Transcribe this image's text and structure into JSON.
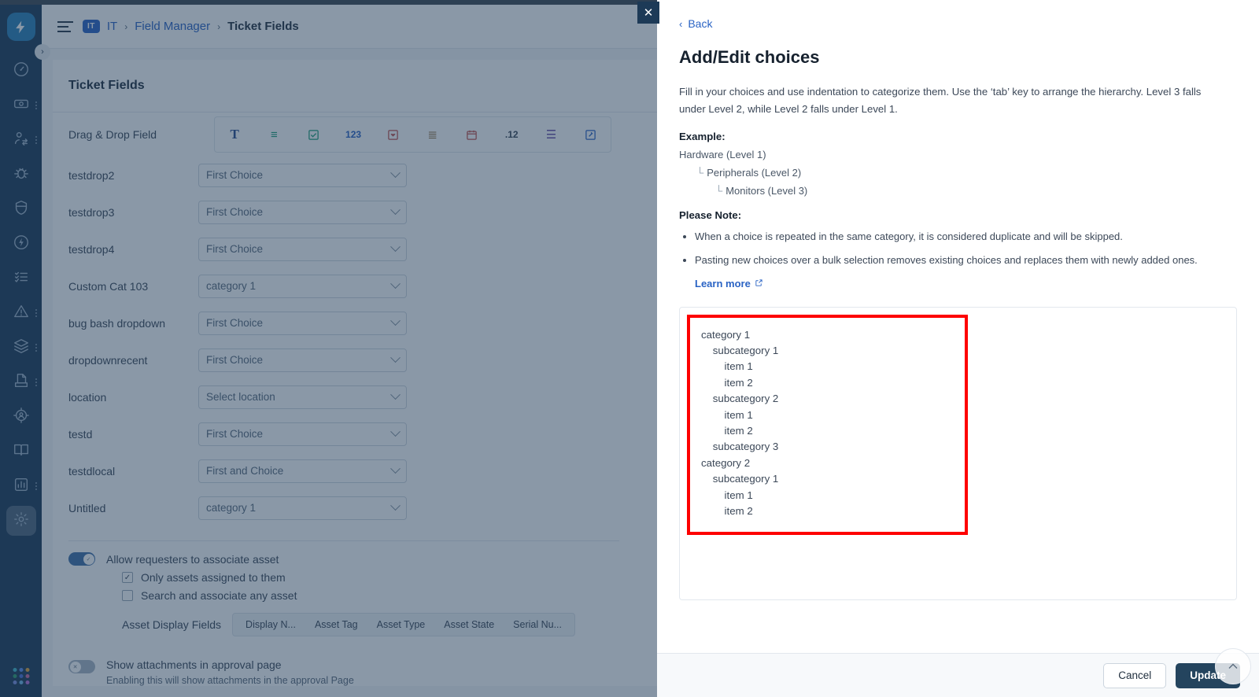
{
  "sidebar": {
    "logo_icon": "bolt-logo-icon",
    "expand_icon": "chevron-right-icon",
    "items": [
      {
        "icon": "gauge-icon",
        "name": "dashboard",
        "dots": false,
        "active": false
      },
      {
        "icon": "ticket-icon",
        "name": "tickets",
        "dots": true,
        "active": false
      },
      {
        "icon": "user-switch-icon",
        "name": "requesters",
        "dots": true,
        "active": false
      },
      {
        "icon": "bug-icon",
        "name": "problems",
        "dots": false,
        "active": false
      },
      {
        "icon": "shield-icon",
        "name": "changes",
        "dots": false,
        "active": false
      },
      {
        "icon": "bolt-circle-icon",
        "name": "releases",
        "dots": false,
        "active": false
      },
      {
        "icon": "checklist-icon",
        "name": "tasks",
        "dots": false,
        "active": false
      },
      {
        "icon": "warning-triangle-icon",
        "name": "alerts",
        "dots": true,
        "active": false
      },
      {
        "icon": "layers-icon",
        "name": "assets",
        "dots": true,
        "active": false
      },
      {
        "icon": "contract-icon",
        "name": "contracts",
        "dots": true,
        "active": false
      },
      {
        "icon": "target-user-icon",
        "name": "projects",
        "dots": false,
        "active": false
      },
      {
        "icon": "book-icon",
        "name": "knowledge-base",
        "dots": false,
        "active": false
      },
      {
        "icon": "chart-icon",
        "name": "analytics",
        "dots": true,
        "active": false
      },
      {
        "icon": "gear-icon",
        "name": "admin-settings",
        "dots": false,
        "active": true
      }
    ],
    "apps_grid_icon": "apps-grid-icon",
    "grid_colors": [
      "#3fb6c8",
      "#5b8def",
      "#e0a43a",
      "#2f9e6f",
      "#4a6fd8",
      "#c86a9e",
      "#7a8fe0",
      "#6fb7e8",
      "#b46fd8"
    ]
  },
  "app": {
    "menu_icon": "hamburger-icon",
    "breadcrumb": {
      "badge": "IT",
      "root": "IT",
      "sep": "›",
      "middle": "Field Manager",
      "current": "Ticket Fields"
    },
    "page_title": "Ticket Fields",
    "drag_drop_label": "Drag & Drop Field",
    "field_types": [
      {
        "name": "text-field-type",
        "glyph": "T",
        "color": "#2a4d8f"
      },
      {
        "name": "paragraph-field-type",
        "glyph": "≡",
        "color": "#1d9e78"
      },
      {
        "name": "checkbox-field-type",
        "glyph": "☑",
        "color": "#1d9e78"
      },
      {
        "name": "number-field-type",
        "glyph": "123",
        "color": "#2a63c4"
      },
      {
        "name": "dropdown-field-type",
        "glyph": "▼",
        "color": "#c0504d"
      },
      {
        "name": "multiselect-field-type",
        "glyph": "≣",
        "color": "#8a6a3a"
      },
      {
        "name": "date-field-type",
        "glyph": "Ὄ5",
        "color": "#c0504d"
      },
      {
        "name": "decimal-field-type",
        "glyph": ".12",
        "color": "#3c4858"
      },
      {
        "name": "list-field-type",
        "glyph": "☰",
        "color": "#6a4fa8"
      },
      {
        "name": "custom-field-type",
        "glyph": "✎",
        "color": "#2a63c4"
      }
    ],
    "rows": [
      {
        "label": "testdrop2",
        "value": "First Choice"
      },
      {
        "label": "testdrop3",
        "value": "First Choice"
      },
      {
        "label": "testdrop4",
        "value": "First Choice"
      },
      {
        "label": "Custom Cat 103",
        "value": "category 1"
      },
      {
        "label": "bug bash dropdown",
        "value": "First Choice"
      },
      {
        "label": "dropdownrecent",
        "value": "First Choice"
      },
      {
        "label": "location",
        "value": "Select location"
      },
      {
        "label": "testd",
        "value": "First Choice"
      },
      {
        "label": "testdlocal",
        "value": "First and Choice"
      },
      {
        "label": "Untitled",
        "value": "category 1"
      }
    ],
    "asset_toggle_label": "Allow requesters to associate asset",
    "asset_toggle_state": "on",
    "asset_checkboxes": [
      {
        "label": "Only assets assigned to them",
        "checked": true
      },
      {
        "label": "Search and associate any asset",
        "checked": false
      }
    ],
    "asset_display_fields_label": "Asset Display Fields",
    "asset_display_chips": [
      "Display N...",
      "Asset Tag",
      "Asset Type",
      "Asset State",
      "Serial Nu..."
    ],
    "attachments_toggle_label": "Show attachments in approval page",
    "attachments_toggle_state": "off",
    "attachments_sub_label": "Enabling this will show attachments in the approval Page",
    "close_icon": "close-icon"
  },
  "panel": {
    "back_label": "Back",
    "back_icon": "chevron-left-icon",
    "title": "Add/Edit choices",
    "description": "Fill in your choices and use indentation to categorize them. Use the ‘tab’ key to arrange the hierarchy. Level 3 falls under Level 2, while Level 2 falls under Level 1.",
    "example_label": "Example:",
    "example_lines": [
      {
        "text": "Hardware (Level 1)",
        "level": 1
      },
      {
        "text": "Peripherals (Level 2)",
        "level": 2
      },
      {
        "text": "Monitors (Level 3)",
        "level": 3
      }
    ],
    "elbow_glyph": "└",
    "note_label": "Please Note:",
    "notes": [
      "When a choice is repeated in the same category, it is considered duplicate and will be skipped.",
      "Pasting new choices over a bulk selection removes existing choices and replaces them with newly added ones."
    ],
    "learn_more_label": "Learn more",
    "learn_more_icon": "external-link-icon",
    "highlight_color": "#fe0000",
    "choices": [
      {
        "text": "category 1",
        "level": 1
      },
      {
        "text": "subcategory 1",
        "level": 2
      },
      {
        "text": "item 1",
        "level": 3
      },
      {
        "text": "item 2",
        "level": 3
      },
      {
        "text": "subcategory 2",
        "level": 2
      },
      {
        "text": "item 1",
        "level": 3
      },
      {
        "text": "item 2",
        "level": 3
      },
      {
        "text": "subcategory 3",
        "level": 2
      },
      {
        "text": "category 2",
        "level": 1
      },
      {
        "text": "subcategory 1",
        "level": 2
      },
      {
        "text": "item 1",
        "level": 3
      },
      {
        "text": "item 2",
        "level": 3
      }
    ],
    "footer": {
      "cancel_label": "Cancel",
      "update_label": "Update",
      "scroll_top_icon": "chevron-up-icon"
    }
  }
}
